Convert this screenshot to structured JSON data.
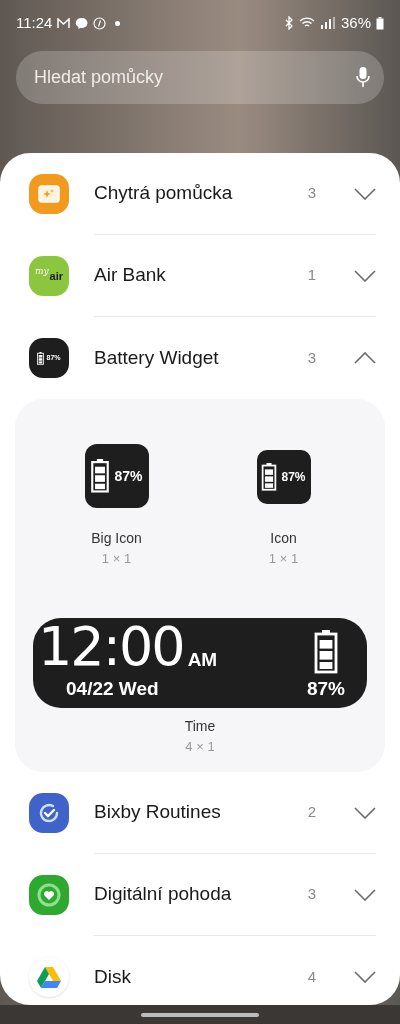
{
  "status_bar": {
    "time": "11:24",
    "battery": "36%"
  },
  "search": {
    "placeholder": "Hledat pomůcky"
  },
  "categories": [
    {
      "name": "Chytrá pomůcka",
      "count": "3",
      "expanded": false
    },
    {
      "name": "Air Bank",
      "count": "1",
      "expanded": false,
      "logo_text": [
        "my",
        "air"
      ]
    },
    {
      "name": "Battery Widget",
      "count": "3",
      "expanded": true,
      "logo_text": [
        "87%"
      ],
      "widgets": [
        {
          "kind": "big_icon",
          "name": "Big Icon",
          "size": "1 × 1",
          "reading": "87%"
        },
        {
          "kind": "icon",
          "name": "Icon",
          "size": "1 × 1",
          "reading": "87%"
        },
        {
          "kind": "time",
          "name": "Time",
          "size": "4 × 1",
          "time": "12:00",
          "meridiem": "AM",
          "date": "04/22 Wed",
          "reading": "87%"
        }
      ]
    },
    {
      "name": "Bixby Routines",
      "count": "2",
      "expanded": false
    },
    {
      "name": "Digitální pohoda",
      "count": "3",
      "expanded": false
    },
    {
      "name": "Disk",
      "count": "4",
      "expanded": false
    }
  ]
}
